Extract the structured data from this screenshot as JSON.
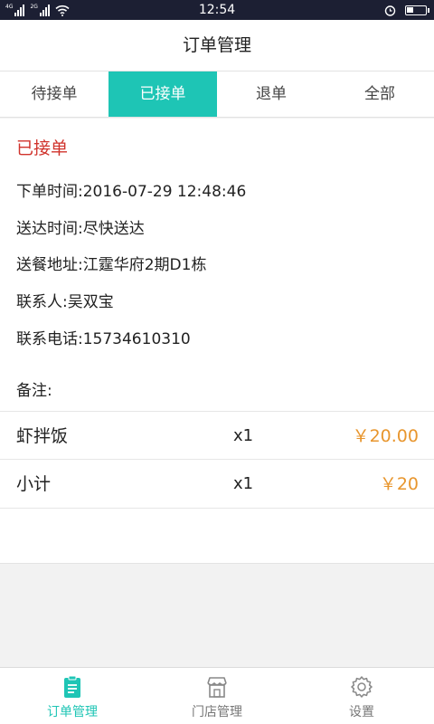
{
  "status_bar": {
    "time": "12:54",
    "sig1_tag": "4G",
    "sig2_tag": "2G"
  },
  "header": {
    "title": "订单管理"
  },
  "tabs": [
    {
      "label": "待接单",
      "active": false
    },
    {
      "label": "已接单",
      "active": true
    },
    {
      "label": "退单",
      "active": false
    },
    {
      "label": "全部",
      "active": false
    }
  ],
  "order": {
    "status": "已接单",
    "order_time": "下单时间:2016-07-29 12:48:46",
    "delivery_time": "送达时间:尽快送达",
    "address": "送餐地址:江霆华府2期D1栋",
    "contact": "联系人:吴双宝",
    "phone": "联系电话:15734610310",
    "remark": "备注:",
    "items": [
      {
        "name": "虾拌饭",
        "qty": "x1",
        "price": "￥20.00"
      }
    ],
    "subtotal": {
      "name": "小计",
      "qty": "x1",
      "price": "￥20"
    }
  },
  "bottom_nav": [
    {
      "label": "订单管理",
      "icon": "clipboard-icon",
      "active": true
    },
    {
      "label": "门店管理",
      "icon": "store-icon",
      "active": false
    },
    {
      "label": "设置",
      "icon": "gear-icon",
      "active": false
    }
  ],
  "colors": {
    "accent": "#1ec5b5",
    "status_red": "#d0332c",
    "price_orange": "#e8962e",
    "status_bar_bg": "#1c1f33"
  }
}
